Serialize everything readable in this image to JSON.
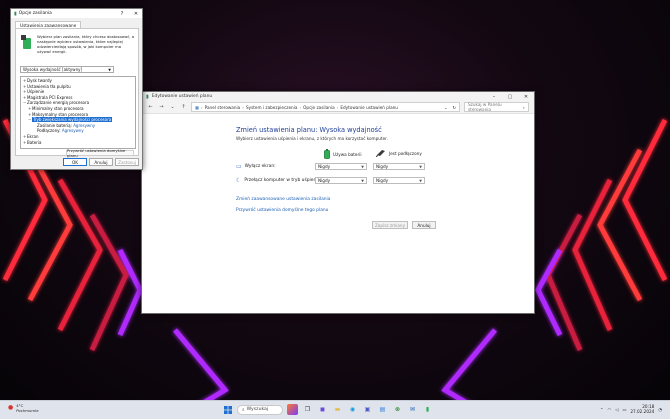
{
  "colors": {
    "accent": "#1a5fb4",
    "heading": "#1e3f96",
    "selection": "#1f6fd0",
    "neon_red": "#ff2a3a",
    "neon_violet": "#b02cff"
  },
  "control_panel": {
    "title": "Edytowanie ustawień planu",
    "breadcrumb": [
      "Panel sterowania",
      "System i zabezpieczenia",
      "Opcje zasilania",
      "Edytowanie ustawień planu"
    ],
    "search_placeholder": "Szukaj w Panelu sterowania",
    "heading": "Zmień ustawienia planu: Wysoka wydajność",
    "description": "Wybierz ustawienia uśpienia i ekranu, z których ma korzystać komputer.",
    "col_battery": "Używa baterii",
    "col_plugged": "Jest podłączony",
    "rows": [
      {
        "label": "Wyłącz ekran:",
        "battery": "Nigdy",
        "plugged": "Nigdy",
        "icon": "monitor-icon"
      },
      {
        "label": "Przełącz komputer w tryb uśpienia:",
        "battery": "Nigdy",
        "plugged": "Nigdy",
        "icon": "moon-icon"
      }
    ],
    "link_advanced": "Zmień zaawansowane ustawienia zasilania",
    "link_restore": "Przywróć ustawienia domyślne tego planu",
    "save_label": "Zapisz zmiany",
    "cancel_label": "Anuluj"
  },
  "dialog": {
    "title": "Opcje zasilania",
    "tab": "Ustawienia zaawansowane",
    "description": "Wybierz plan zasilania, który chcesz dostosować, a następnie wybierz ustawienia, które najlepiej odzwierciedlają sposób, w jaki komputer ma używać energii.",
    "plan": "Wysoka wydajność [aktywny]",
    "tree": [
      {
        "label": "Dysk twardy",
        "indent": 0,
        "expander": "+"
      },
      {
        "label": "Ustawienia tła pulpitu",
        "indent": 0,
        "expander": "+"
      },
      {
        "label": "Uśpienie",
        "indent": 0,
        "expander": "+"
      },
      {
        "label": "Magistrala PCI Express",
        "indent": 0,
        "expander": "+"
      },
      {
        "label": "Zarządzanie energią procesora",
        "indent": 0,
        "expander": "−"
      },
      {
        "label": "Minimalny stan procesora",
        "indent": 1,
        "expander": "+"
      },
      {
        "label": "Maksymalny stan procesora",
        "indent": 1,
        "expander": "+"
      },
      {
        "label": "Tryb zwiększania wydajności procesora",
        "indent": 1,
        "expander": "−",
        "highlighted": true
      },
      {
        "label": "Zasilanie baterią:",
        "indent": 2,
        "expander": "",
        "value": "Agresywny"
      },
      {
        "label": "Podłączony:",
        "indent": 2,
        "expander": "",
        "value": "Agresywny"
      },
      {
        "label": "Ekran",
        "indent": 0,
        "expander": "+"
      },
      {
        "label": "Bateria",
        "indent": 0,
        "expander": "+"
      }
    ],
    "restore_label": "Przywróć ustawienia domyślne planu",
    "ok_label": "OK",
    "cancel_label": "Anuluj",
    "apply_label": "Zastosuj"
  },
  "taskbar": {
    "temperature": "4°C",
    "weather_desc": "Pochmurnie",
    "search_placeholder": "Wyszukaj",
    "time": "20:18",
    "date": "27.02.2024",
    "icons": [
      "windows-start-icon",
      "search-icon",
      "chat-icon",
      "file-explorer-icon",
      "edge-icon",
      "teams-icon",
      "store-icon",
      "xbox-icon",
      "mail-icon",
      "power-icon"
    ]
  }
}
